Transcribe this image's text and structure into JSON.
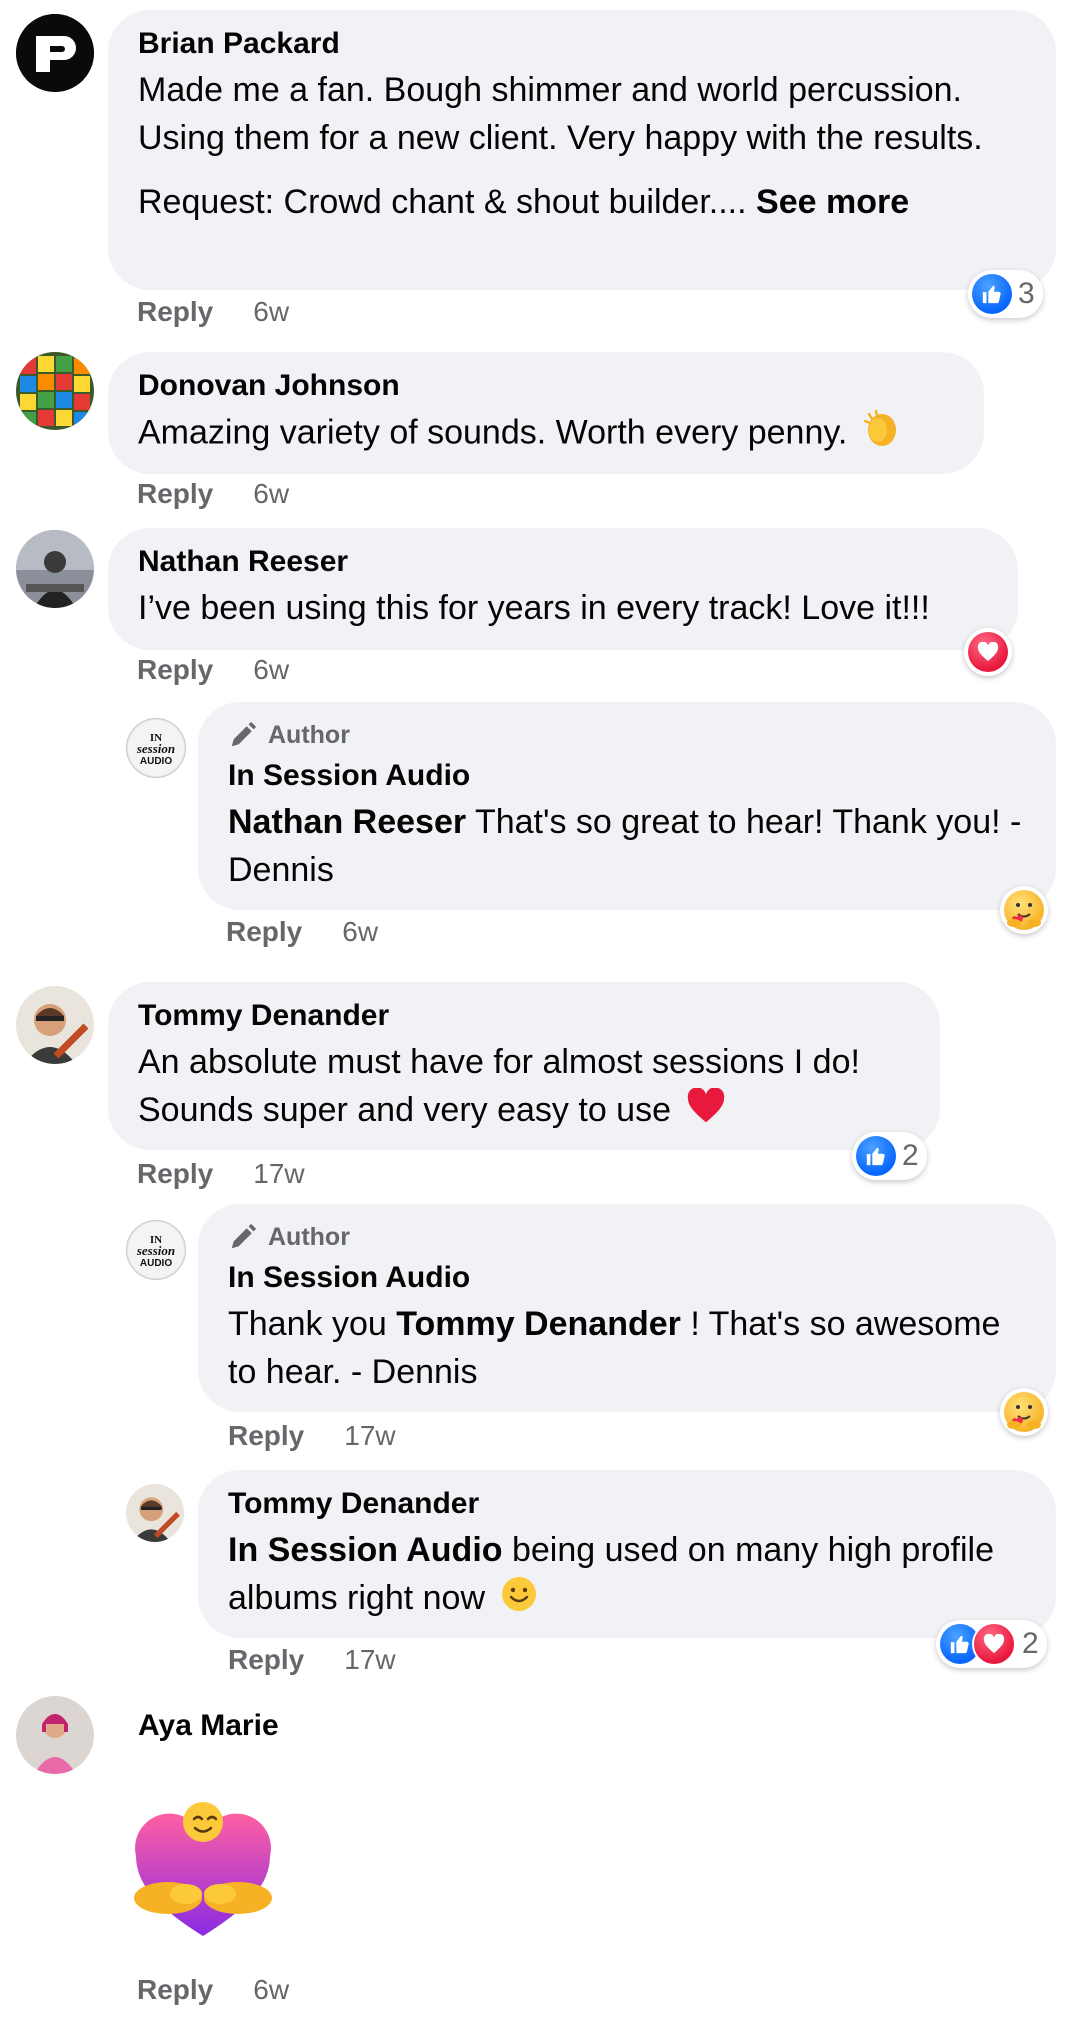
{
  "comments": [
    {
      "author": "Brian Packard",
      "lines": [
        "Made me a fan. Bough shimmer and world percussion. Using them for a new client. Very happy with the results."
      ],
      "request": "Request: Crowd chant & shout builder....",
      "see_more": "See more",
      "reply": "Reply",
      "time": "6w",
      "reactions": {
        "count": "3"
      }
    },
    {
      "author": "Donovan Johnson",
      "text": "Amazing variety of sounds. Worth every penny.",
      "reply": "Reply",
      "time": "6w"
    },
    {
      "author": "Nathan Reeser",
      "text": "I’ve been using this for years in every track! Love it!!!",
      "reply": "Reply",
      "time": "6w",
      "reply_item": {
        "badge": "Author",
        "author": "In Session Audio",
        "mention": "Nathan Reeser",
        "text": " That's so great to hear! Thank you! - Dennis",
        "reply": "Reply",
        "time": "6w"
      }
    },
    {
      "author": "Tommy Denander",
      "text": "An absolute must have for almost sessions I do! Sounds super and very easy to use",
      "reply": "Reply",
      "time": "17w",
      "reactions": {
        "count": "2"
      },
      "reply_item": {
        "badge": "Author",
        "author": "In Session Audio",
        "prefix": "Thank you ",
        "mention": "Tommy Denander",
        "text": " ! That's so awesome to hear. - Dennis",
        "reply": "Reply",
        "time": "17w"
      },
      "reply_item_2": {
        "author": "Tommy Denander",
        "mention": "In Session Audio",
        "text": " being used on many high profile albums right now",
        "reply": "Reply",
        "time": "17w",
        "reactions": {
          "count": "2"
        }
      }
    },
    {
      "author": "Aya Marie",
      "reply": "Reply",
      "time": "6w"
    }
  ],
  "avatars": {
    "isa_logo_text": "IN SESSION AUDIO"
  },
  "colors": {
    "bubble": "#f0f2f5",
    "like_blue": "#0866ff",
    "love_red": "#e8193c",
    "meta_gray": "#65676b"
  },
  "icons": [
    "like-icon",
    "love-icon",
    "care-icon",
    "clap-emoji",
    "heart-emoji",
    "smile-emoji",
    "pencil-icon",
    "hug-sticker"
  ]
}
